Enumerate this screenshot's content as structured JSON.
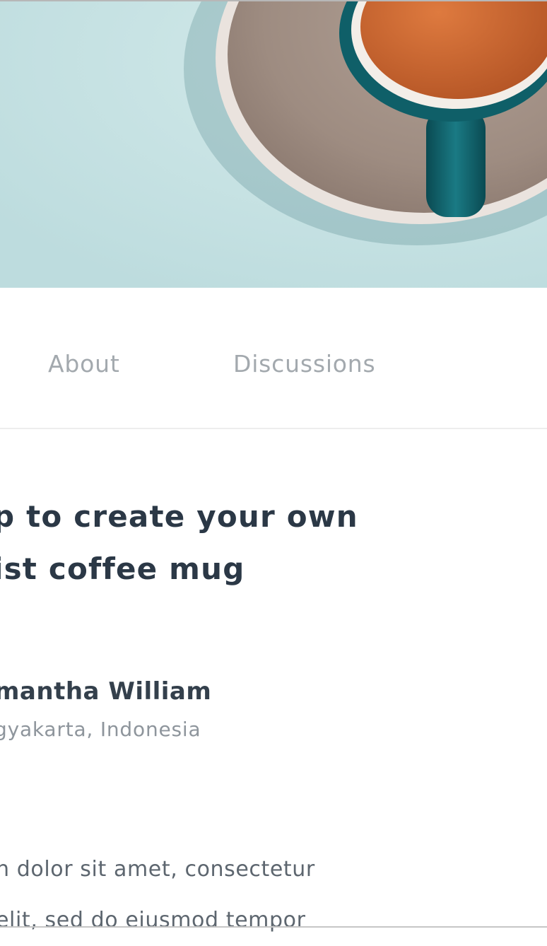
{
  "hero": {
    "image_subject": "coffee-cup-on-saucer",
    "colors": {
      "background": "#c5e2e3",
      "saucer": "#a08f85",
      "cup": "#0f5f68",
      "coffee": "#c8612c"
    }
  },
  "tabs": [
    {
      "label": "About"
    },
    {
      "label": "Discussions"
    }
  ],
  "article": {
    "title_lines": [
      "p to create your own",
      "ist coffee mug"
    ],
    "author": {
      "name": "mantha William",
      "location": "gyakarta, Indonesia"
    },
    "body_lines": [
      "n dolor sit amet, consectetur",
      "elit, sed do eiusmod tempor"
    ]
  }
}
